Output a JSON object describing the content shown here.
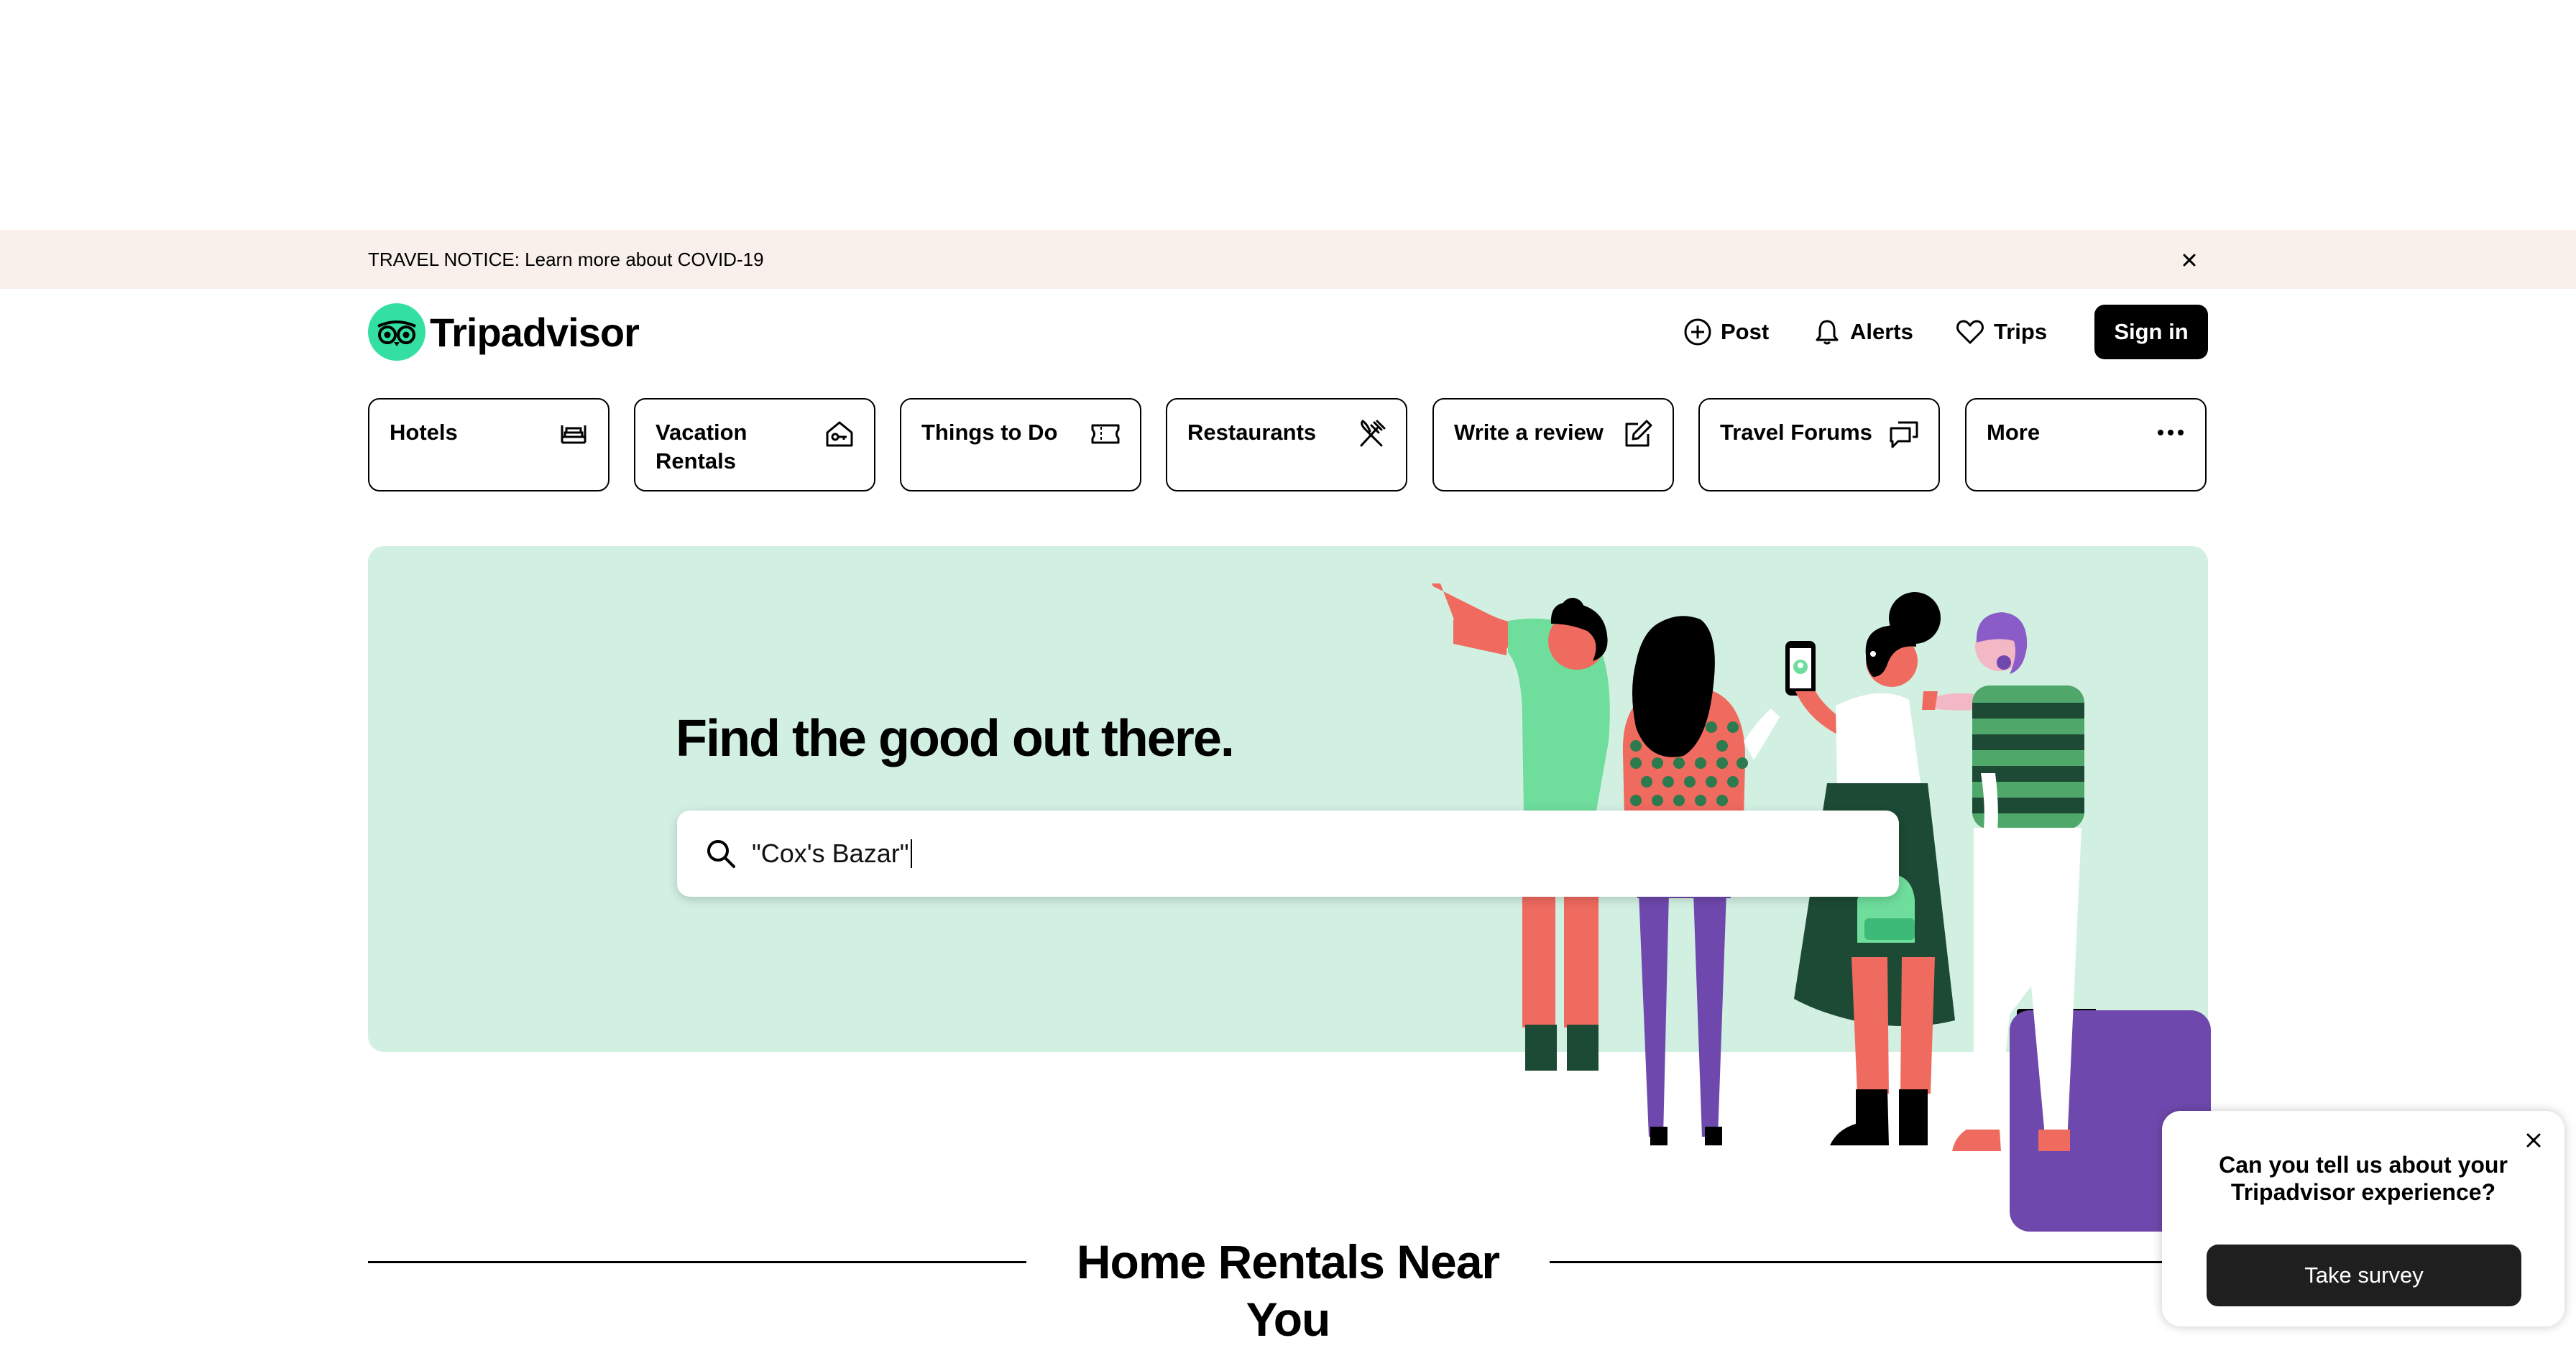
{
  "notice": {
    "text": "TRAVEL NOTICE: Learn more about COVID-19",
    "close_icon": "close-icon"
  },
  "header": {
    "brand": "Tripadvisor",
    "brand_color": "#34e0a1",
    "post_label": "Post",
    "alerts_label": "Alerts",
    "trips_label": "Trips",
    "signin_label": "Sign in"
  },
  "categories": [
    {
      "label": "Hotels",
      "icon": "bed-icon"
    },
    {
      "label": "Vacation Rentals",
      "icon": "house-key-icon"
    },
    {
      "label": "Things to Do",
      "icon": "ticket-icon"
    },
    {
      "label": "Restaurants",
      "icon": "fork-knife-icon"
    },
    {
      "label": "Write a review",
      "icon": "edit-icon"
    },
    {
      "label": "Travel Forums",
      "icon": "chat-bubbles-icon"
    },
    {
      "label": "More",
      "icon": "more-dots-icon"
    }
  ],
  "hero": {
    "title": "Find the good out there.",
    "search_value": "\"Cox's Bazar\"",
    "background_color": "#d2f0e2"
  },
  "section": {
    "title": "Home Rentals Near You"
  },
  "survey": {
    "question": "Can you tell us about your Tripadvisor experience?",
    "button_label": "Take survey"
  }
}
